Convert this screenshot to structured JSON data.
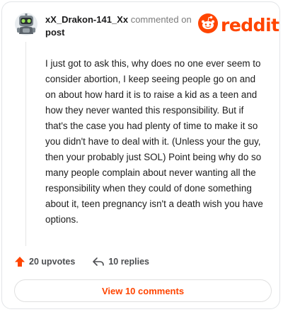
{
  "comment": {
    "username": "xX_Drakon-141_Xx",
    "commented_on": "commented on",
    "post_link": "post",
    "body": "I just got to ask this, why does no one ever seem to consider abortion, I keep seeing people go on and on about how hard it is to raise a kid as a teen and how they never wanted this responsibility. But if that's the case you had plenty of time to make it so you didn't have to deal with it. (Unless your the guy, then your probably just SOL) Point being why do so many people complain about never wanting all the responsibility when they could of done something about it, teen pregnancy isn't a death wish you have options."
  },
  "brand": {
    "logo_text": "reddit",
    "icon": "reddit-alien-icon",
    "color": "#ff4500"
  },
  "actions": {
    "upvotes_label": "20 upvotes",
    "upvote_icon": "upvote-arrow-icon",
    "replies_label": "10 replies",
    "reply_icon": "reply-arrow-icon"
  },
  "footer": {
    "view_comments_label": "View 10 comments"
  }
}
